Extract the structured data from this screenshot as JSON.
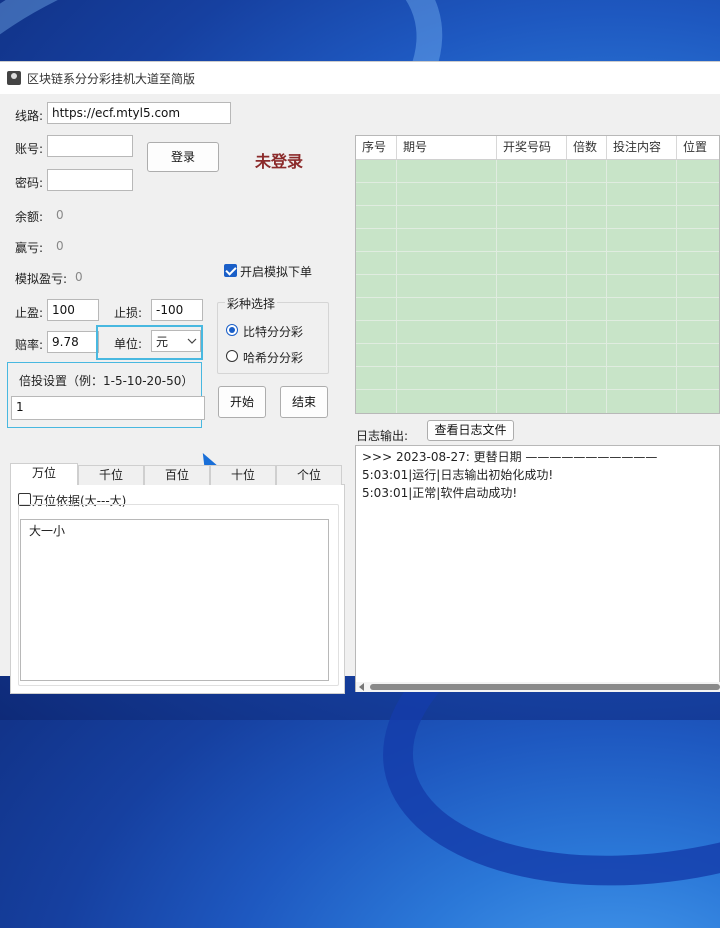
{
  "window": {
    "title": "区块链系分分彩挂机大道至简版"
  },
  "login": {
    "route_label": "线路:",
    "route_value": "https://ecf.mtyl5.com",
    "account_label": "账号:",
    "account_value": "",
    "password_label": "密码:",
    "password_value": "",
    "login_button": "登录",
    "status": "未登录",
    "status_color": "#8b2a2a"
  },
  "stats": {
    "balance_label": "余额:",
    "balance_value": "0",
    "profit_label": "赢亏:",
    "profit_value": "0",
    "sim_profit_label": "模拟盈亏:",
    "sim_profit_value": "0"
  },
  "sim_order": {
    "label": "开启模拟下单",
    "checked": true
  },
  "limits": {
    "take_profit_label": "止盈:",
    "take_profit_value": "100",
    "stop_loss_label": "止损:",
    "stop_loss_value": "-100",
    "odds_label": "赔率:",
    "odds_value": "9.78",
    "unit_label": "单位:",
    "unit_value": "元"
  },
  "lottery": {
    "group_title": "彩种选择",
    "options": [
      {
        "label": "比特分分彩",
        "selected": true
      },
      {
        "label": "哈希分分彩",
        "selected": false
      }
    ]
  },
  "multiplier": {
    "label": "倍投设置（例：1-5-10-20-50）",
    "value": "1"
  },
  "actions": {
    "start": "开始",
    "stop": "结束"
  },
  "positions": {
    "tabs": [
      "万位",
      "千位",
      "百位",
      "十位",
      "个位"
    ],
    "active_tab": "万位",
    "basis_label": "万位依据(大---大)",
    "basis_checked": false,
    "rule_text": "大一小"
  },
  "grid": {
    "columns": [
      "序号",
      "期号",
      "开奖号码",
      "倍数",
      "投注内容",
      "位置"
    ]
  },
  "log": {
    "label": "日志输出:",
    "view_button": "查看日志文件",
    "lines": [
      ">>> 2023-08-27: 更替日期 ———————————",
      "5:03:01|运行|日志输出初始化成功!",
      "5:03:01|正常|软件启动成功!"
    ]
  },
  "colors": {
    "accent": "#1a5fc8",
    "grid_body": "#c8e4c8",
    "highlight": "#48b8e0"
  }
}
